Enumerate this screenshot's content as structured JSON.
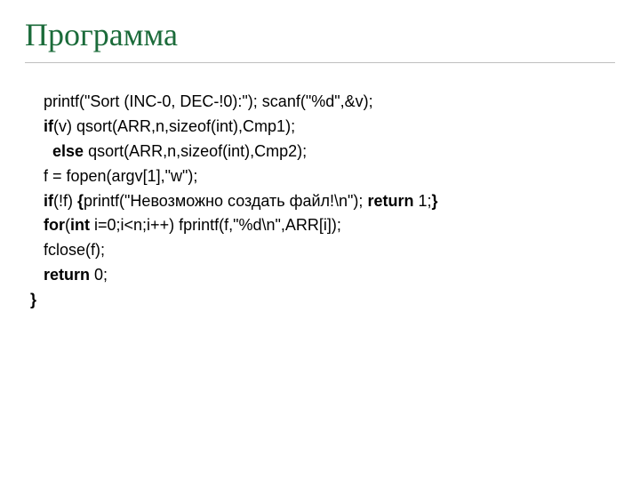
{
  "title": "Программа",
  "code": {
    "l1": "   printf(\"Sort (INC-0, DEC-!0):\"); scanf(\"%d\",&v);",
    "l2a": "   ",
    "l2_if": "if",
    "l2b": "(v) qsort(ARR,n,sizeof(int),Cmp1);",
    "l3a": "     ",
    "l3_else": "else",
    "l3b": " qsort(ARR,n,sizeof(int),Cmp2);",
    "l4": "   f = fopen(argv[1],\"w\");",
    "l5a": "   ",
    "l5_if": "if",
    "l5b": "(!f) ",
    "l5_ob": "{",
    "l5c": "printf(\"Невозможно создать файл!\\n\"); ",
    "l5_return": "return",
    "l5d": " 1;",
    "l5_cb": "}",
    "l6a": "   ",
    "l6_for": "for",
    "l6b": "(",
    "l6_int": "int",
    "l6c": " i=0;i<n;i++) fprintf(f,\"%d\\n\",ARR[i]);",
    "l7": "   fclose(f);",
    "l8a": "   ",
    "l8_return": "return",
    "l8b": " 0;",
    "l9": "}"
  }
}
